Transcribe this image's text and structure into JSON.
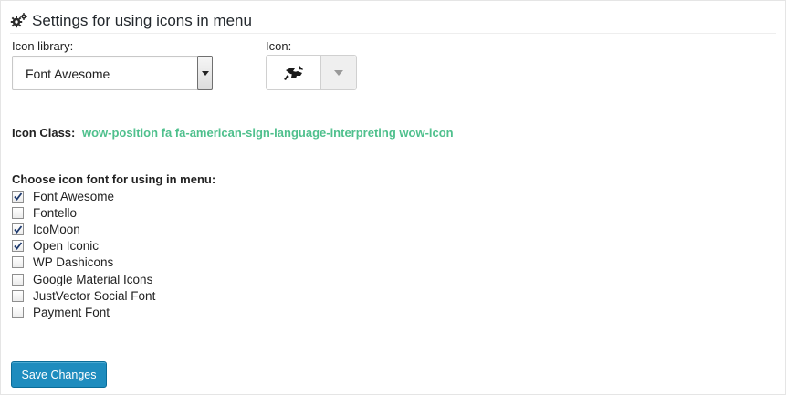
{
  "header": {
    "title": "Settings for using icons in menu",
    "icon": "gears-icon"
  },
  "library": {
    "label": "Icon library:",
    "selected": "Font Awesome",
    "arrow_icon": "triangle-down-icon"
  },
  "icon_picker": {
    "label": "Icon:",
    "preview_icon": "american-sign-language-interpreting-icon",
    "toggle_icon": "caret-down-icon"
  },
  "icon_class": {
    "label": "Icon Class:",
    "value": "wow-position fa fa-american-sign-language-interpreting wow-icon"
  },
  "fonts": {
    "title": "Choose icon font for using in menu:",
    "items": [
      {
        "label": "Font Awesome",
        "checked": true
      },
      {
        "label": "Fontello",
        "checked": false
      },
      {
        "label": "IcoMoon",
        "checked": true
      },
      {
        "label": "Open Iconic",
        "checked": true
      },
      {
        "label": "WP Dashicons",
        "checked": false
      },
      {
        "label": "Google Material Icons",
        "checked": false
      },
      {
        "label": "JustVector Social Font",
        "checked": false
      },
      {
        "label": "Payment Font",
        "checked": false
      }
    ]
  },
  "actions": {
    "save_label": "Save Changes"
  },
  "colors": {
    "accent_green": "#4fc08d",
    "button_blue": "#1e8cbe"
  }
}
